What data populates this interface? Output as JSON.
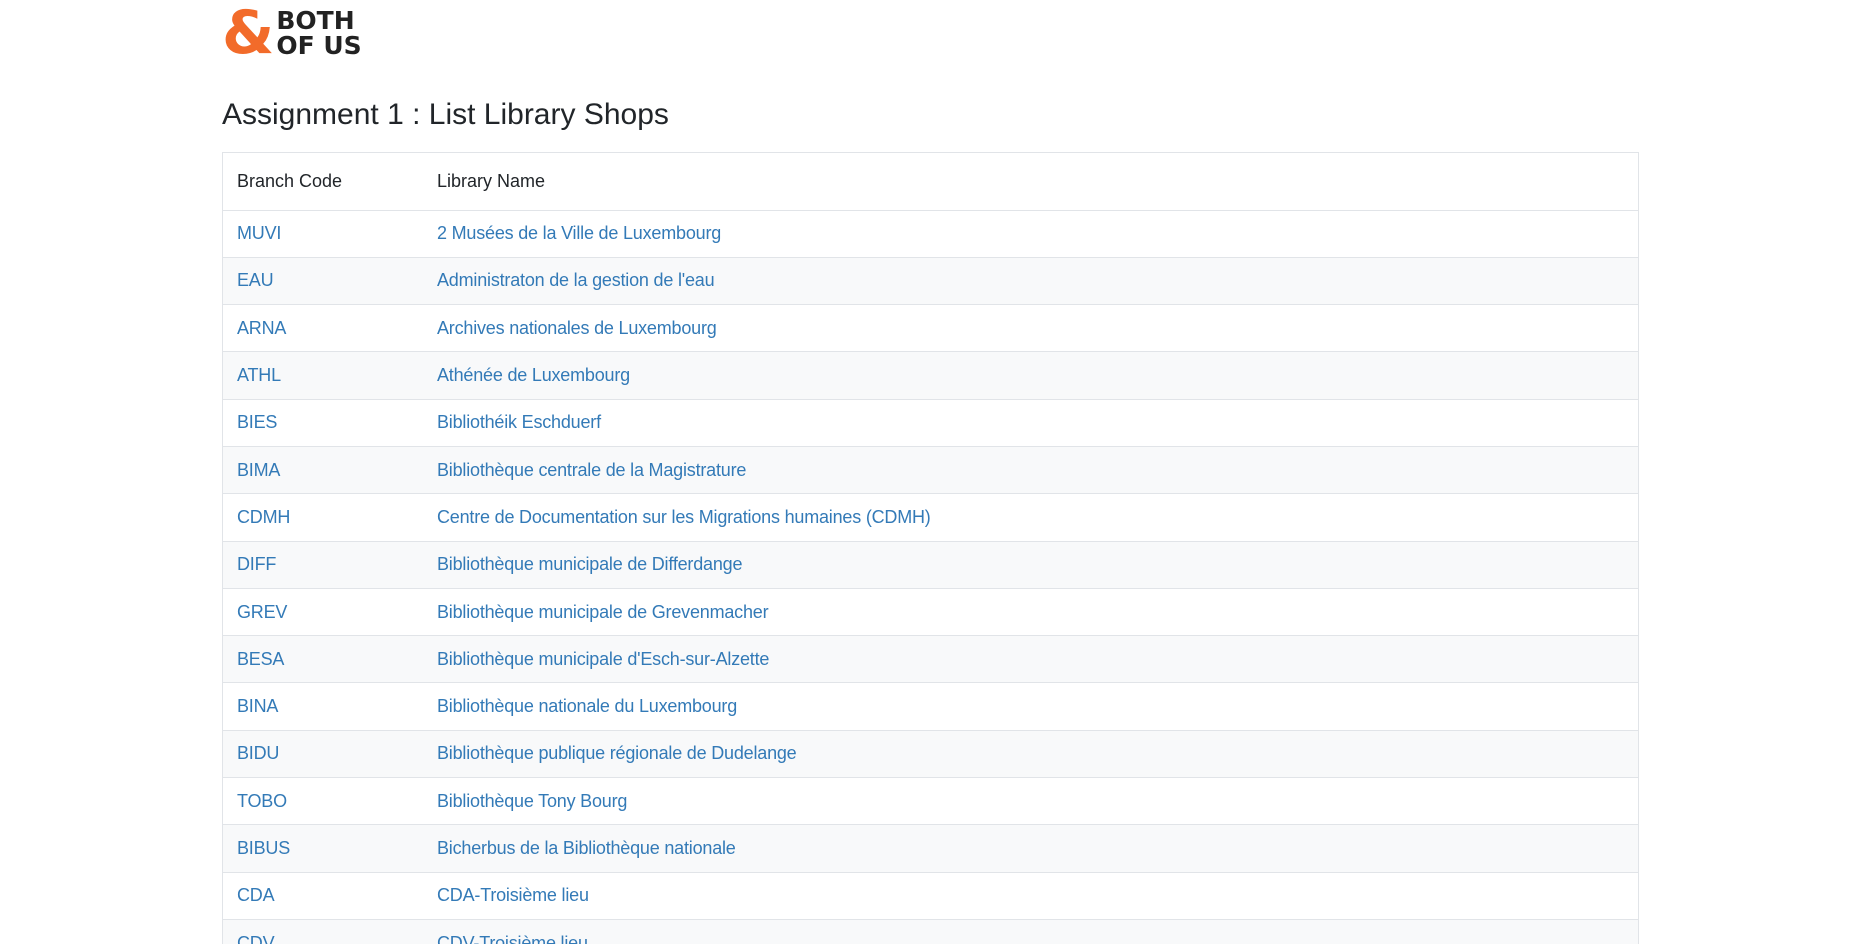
{
  "logo": {
    "symbol": "&",
    "line1": "BOTH",
    "line2": "OF US"
  },
  "page_title": "Assignment 1 : List Library Shops",
  "table": {
    "headers": [
      "Branch Code",
      "Library Name"
    ],
    "rows": [
      {
        "code": "MUVI",
        "name": "2 Musées de la Ville de Luxembourg"
      },
      {
        "code": "EAU",
        "name": "Administraton de la gestion de l'eau"
      },
      {
        "code": "ARNA",
        "name": "Archives nationales de Luxembourg"
      },
      {
        "code": "ATHL",
        "name": "Athénée de Luxembourg"
      },
      {
        "code": "BIES",
        "name": "Bibliothéik Eschduerf"
      },
      {
        "code": "BIMA",
        "name": "Bibliothèque centrale de la Magistrature"
      },
      {
        "code": "CDMH",
        "name": "Centre de Documentation sur les Migrations humaines (CDMH)"
      },
      {
        "code": "DIFF",
        "name": "Bibliothèque municipale de Differdange"
      },
      {
        "code": "GREV",
        "name": "Bibliothèque municipale de Grevenmacher"
      },
      {
        "code": "BESA",
        "name": "Bibliothèque municipale d'Esch-sur-Alzette"
      },
      {
        "code": "BINA",
        "name": "Bibliothèque nationale du Luxembourg"
      },
      {
        "code": "BIDU",
        "name": "Bibliothèque publique régionale de Dudelange"
      },
      {
        "code": "TOBO",
        "name": "Bibliothèque Tony Bourg"
      },
      {
        "code": "BIBUS",
        "name": "Bicherbus de la Bibliothèque nationale"
      },
      {
        "code": "CDA",
        "name": "CDA-Troisième lieu"
      },
      {
        "code": "CDV",
        "name": "CDV-Troisième lieu"
      }
    ]
  },
  "colors": {
    "link": "#337ab7",
    "logo_accent": "#f26b2a",
    "stripe": "#f8f9fa",
    "border": "#e1e4e8"
  }
}
